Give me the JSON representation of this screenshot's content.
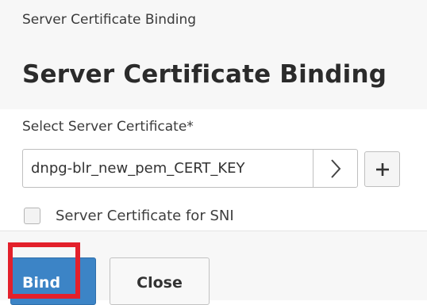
{
  "header": {
    "breadcrumb": "Server Certificate Binding",
    "title": "Server Certificate Binding"
  },
  "form": {
    "select_label": "Select Server Certificate*",
    "select_value": "dnpg-blr_new_pem_CERT_KEY",
    "arrow_icon": "chevron-right-icon",
    "add_icon": "plus-icon",
    "sni_checkbox_label": "Server Certificate for SNI",
    "sni_checked": false
  },
  "footer": {
    "bind_label": "Bind",
    "close_label": "Close"
  },
  "colors": {
    "primary_button": "#3c84c6",
    "highlight_border": "#e3202b"
  }
}
